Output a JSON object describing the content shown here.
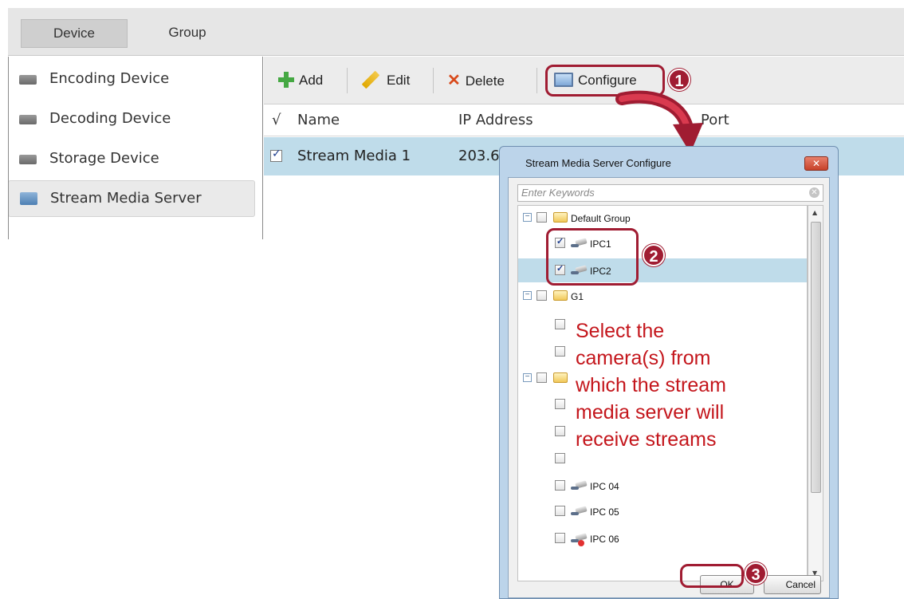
{
  "tabs": {
    "device": "Device",
    "group": "Group"
  },
  "sidebar": {
    "items": [
      {
        "label": "Encoding Device"
      },
      {
        "label": "Decoding Device"
      },
      {
        "label": "Storage Device"
      },
      {
        "label": "Stream Media Server",
        "selected": true
      }
    ]
  },
  "toolbar": {
    "add": "Add",
    "edit": "Edit",
    "delete": "Delete",
    "configure": "Configure"
  },
  "table": {
    "columns": {
      "check": "√",
      "name": "Name",
      "ip": "IP Address",
      "port": "Port"
    },
    "rows": [
      {
        "checked": true,
        "name": "Stream Media 1",
        "ip": "203.6"
      }
    ]
  },
  "dialog": {
    "title": "Stream Media Server Configure",
    "close": "✕",
    "search_placeholder": "Enter Keywords",
    "tree": {
      "default_group": "Default Group",
      "ipc1": "IPC1",
      "ipc2": "IPC2",
      "g1": "G1",
      "ipc04": "IPC 04",
      "ipc05": "IPC 05",
      "ipc06": "IPC 06"
    },
    "ok": "OK",
    "cancel": "Cancel"
  },
  "annotations": {
    "step1": "1",
    "step2": "2",
    "step3": "3",
    "note": "Select the camera(s) from which the stream media server will receive streams",
    "accent_color": "#a01c32",
    "note_color": "#c4161c"
  }
}
